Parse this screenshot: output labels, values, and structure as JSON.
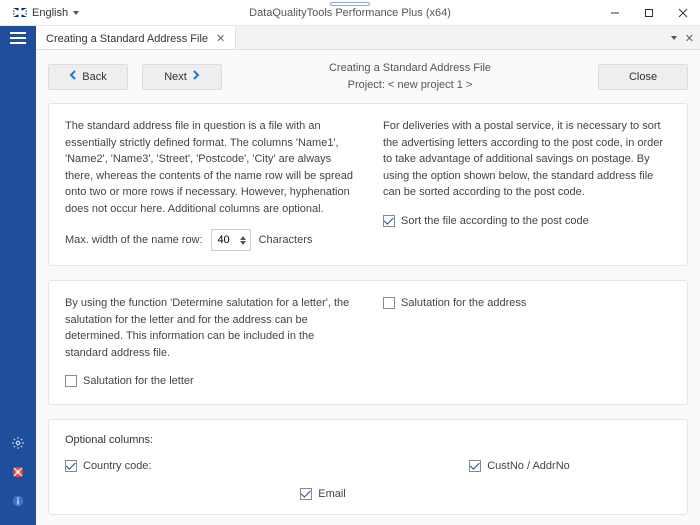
{
  "window": {
    "language_label": "English",
    "title": "DataQualityTools Performance Plus (x64)"
  },
  "tab": {
    "label": "Creating a Standard Address File"
  },
  "header": {
    "back": "Back",
    "next": "Next",
    "close": "Close",
    "title": "Creating a Standard Address File",
    "project": "Project: < new project 1 >"
  },
  "panel1": {
    "left_text": "The standard address file in question is a file with an essentially strictly defined format. The columns 'Name1', 'Name2', 'Name3', 'Street', 'Postcode', 'City' are always there, whereas the contents of the name row will be spread onto two or more rows if necessary. However, hyphenation does not occur here. Additional columns are optional.",
    "right_text": "For deliveries with a postal service, it is necessary to sort the advertising letters according to the post code, in order to take advantage of additional savings on postage. By using the option shown below, the standard address file can be sorted according to the post code.",
    "max_width_label": "Max. width of the name row:",
    "max_width_value": "40",
    "characters_label": "Characters",
    "sort_label": "Sort the file according to the post code",
    "sort_checked": true
  },
  "panel2": {
    "left_text": "By using the function 'Determine salutation for a letter', the salutation for the letter and for the address can be determined. This information can be included in the standard address file.",
    "salutation_letter_label": "Salutation for the letter",
    "salutation_letter_checked": false,
    "salutation_address_label": "Salutation for the address",
    "salutation_address_checked": false
  },
  "panel3": {
    "heading": "Optional columns:",
    "country_label": "Country code:",
    "country_checked": true,
    "cust_label": "CustNo / AddrNo",
    "cust_checked": true,
    "email_label": "Email",
    "email_checked": true
  }
}
